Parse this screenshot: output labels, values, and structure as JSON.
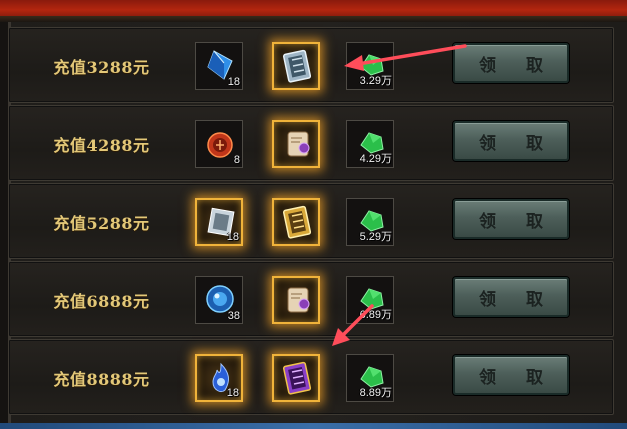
{
  "rows": [
    {
      "title": "充值3288元",
      "slot1": {
        "icon": "blue-crystal-icon",
        "qty": "18"
      },
      "slot2": {
        "icon": "silver-scroll-box-icon",
        "qty": ""
      },
      "slot3": {
        "icon": "green-jade-icon",
        "qty": "3.29万"
      },
      "claim_label": "领 取"
    },
    {
      "title": "充值4288元",
      "slot1": {
        "icon": "red-seal-orb-icon",
        "qty": "8"
      },
      "slot2": {
        "icon": "parchment-scroll-icon",
        "qty": ""
      },
      "slot3": {
        "icon": "green-jade-icon",
        "qty": "4.29万"
      },
      "claim_label": "领 取"
    },
    {
      "title": "充值5288元",
      "slot1": {
        "icon": "silver-tablet-icon",
        "qty": "18"
      },
      "slot2": {
        "icon": "gold-scroll-box-icon",
        "qty": ""
      },
      "slot3": {
        "icon": "green-jade-icon",
        "qty": "5.29万"
      },
      "claim_label": "领 取"
    },
    {
      "title": "充值6888元",
      "slot1": {
        "icon": "blue-gem-orb-icon",
        "qty": "38"
      },
      "slot2": {
        "icon": "parchment-scroll-icon",
        "qty": ""
      },
      "slot3": {
        "icon": "green-jade-icon",
        "qty": "6.89万"
      },
      "claim_label": "领 取"
    },
    {
      "title": "充值8888元",
      "slot1": {
        "icon": "blue-spirit-flame-icon",
        "qty": "18"
      },
      "slot2": {
        "icon": "purple-scroll-box-icon",
        "qty": ""
      },
      "slot3": {
        "icon": "green-jade-icon",
        "qty": "8.89万"
      },
      "claim_label": "领 取"
    }
  ],
  "colors": {
    "title_gold": "#e3c878",
    "glow_gold": "#f0b33a",
    "button": "#4d5f5a",
    "arrow": "#ff4d5a"
  }
}
